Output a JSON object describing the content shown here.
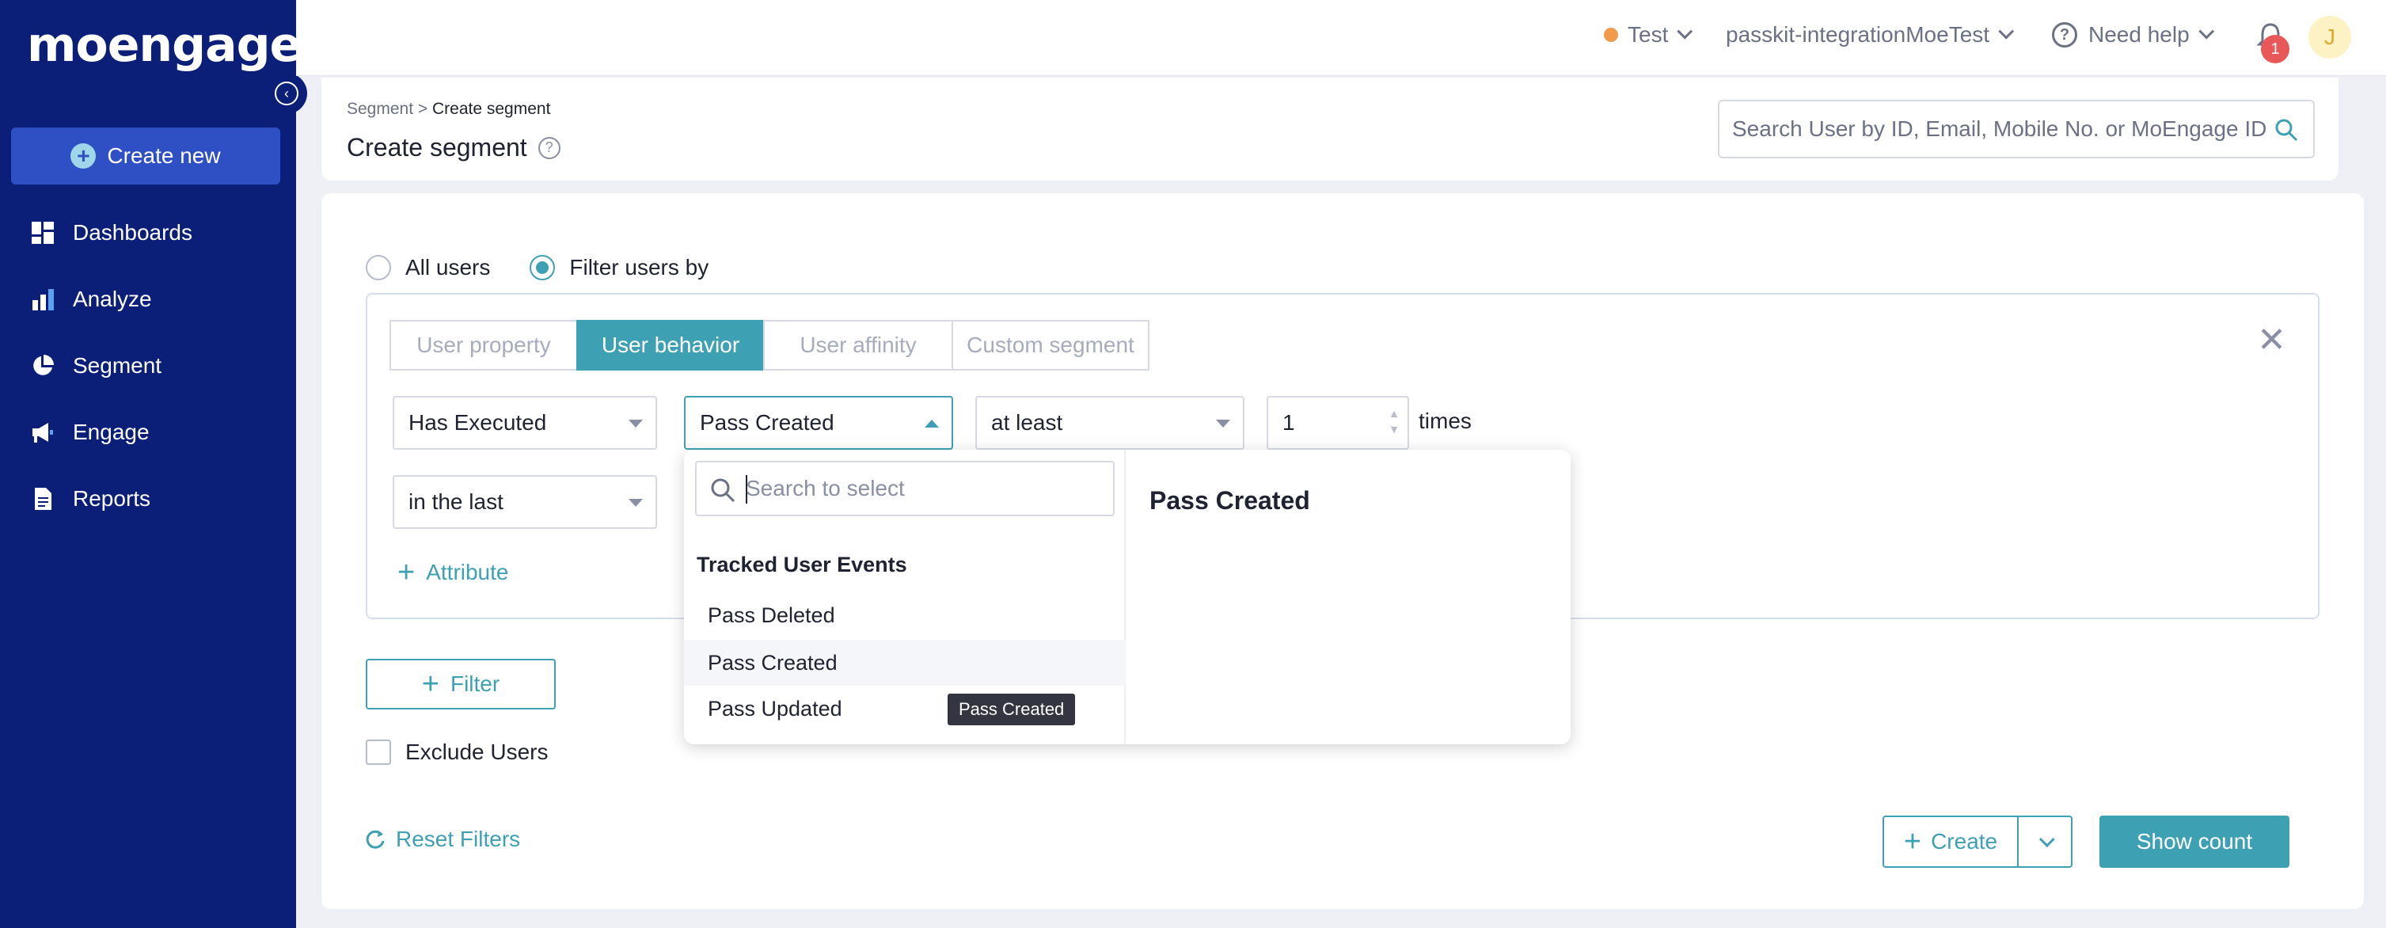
{
  "sidebar": {
    "logo": "moengage",
    "create_new": "Create new",
    "items": [
      {
        "label": "Dashboards",
        "icon": "dashboard-icon"
      },
      {
        "label": "Analyze",
        "icon": "bar-chart-icon"
      },
      {
        "label": "Segment",
        "icon": "pie-chart-icon"
      },
      {
        "label": "Engage",
        "icon": "megaphone-icon"
      },
      {
        "label": "Reports",
        "icon": "document-icon"
      }
    ]
  },
  "topbar": {
    "environment": "Test",
    "workspace": "passkit-integrationMoeTest",
    "help": "Need help",
    "notification_count": "1",
    "avatar_initial": "J"
  },
  "header": {
    "breadcrumb_root": "Segment >",
    "breadcrumb_current": "Create segment",
    "title": "Create segment",
    "search_placeholder": "Search User by ID, Email, Mobile No. or MoEngage ID"
  },
  "filter": {
    "radio_all": "All users",
    "radio_filter": "Filter users by",
    "tabs": [
      "User property",
      "User behavior",
      "User affinity",
      "Custom segment"
    ],
    "condition": "Has Executed",
    "event": "Pass Created",
    "frequency": "at least",
    "count": "1",
    "times_label": "times",
    "time_window": "in the last",
    "attribute_link": "Attribute"
  },
  "dropdown": {
    "search_placeholder": "Search to select",
    "group_label": "Tracked User Events",
    "items": [
      "Pass Deleted",
      "Pass Created",
      "Pass Updated"
    ],
    "preview_title": "Pass Created",
    "tooltip": "Pass Created"
  },
  "actions": {
    "filter_button": "Filter",
    "exclude_users": "Exclude Users",
    "reset_filters": "Reset Filters",
    "create_button": "Create",
    "show_count": "Show count"
  },
  "colors": {
    "sidebar_bg": "#0b1f78",
    "accent": "#3ea1b3",
    "create_new_bg": "#2f4fc4",
    "badge": "#e95858"
  }
}
